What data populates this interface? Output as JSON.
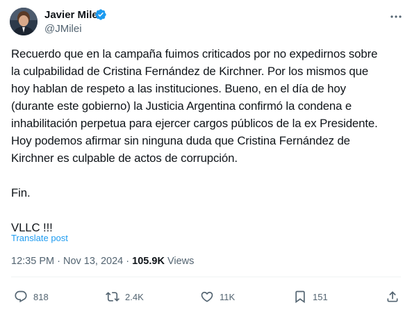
{
  "author": {
    "name": "Javier Milei",
    "handle": "@JMilei",
    "verified_color": "#1d9bf0"
  },
  "post": {
    "paragraphs": [
      [
        "Recuerdo que en la campaña fuimos criticados por no expedirnos sobre",
        "la culpabilidad de Cristina Fernández de Kirchner. Por los mismos que",
        "hoy hablan de respeto a las instituciones. Bueno, en el día de hoy",
        "(durante este gobierno) la Justicia Argentina confirmó la condena e",
        "inhabilitación perpetua para ejercer cargos públicos de la ex Presidente.",
        "Hoy podemos afirmar sin ninguna duda que Cristina Fernández de",
        "Kirchner es culpable de actos de corrupción."
      ],
      [
        "Fin."
      ],
      [
        "VLLC !!!"
      ]
    ],
    "translate_label": "Translate post",
    "time": "12:35 PM",
    "separator": "·",
    "date": "Nov 13, 2024",
    "views_count": "105.9K",
    "views_label": "Views"
  },
  "actions": {
    "replies": "818",
    "reposts": "2.4K",
    "likes": "11K",
    "bookmarks": "151"
  },
  "icons": [
    "more-icon",
    "reply-icon",
    "repost-icon",
    "like-icon",
    "bookmark-icon",
    "share-icon",
    "verified-badge-icon"
  ]
}
